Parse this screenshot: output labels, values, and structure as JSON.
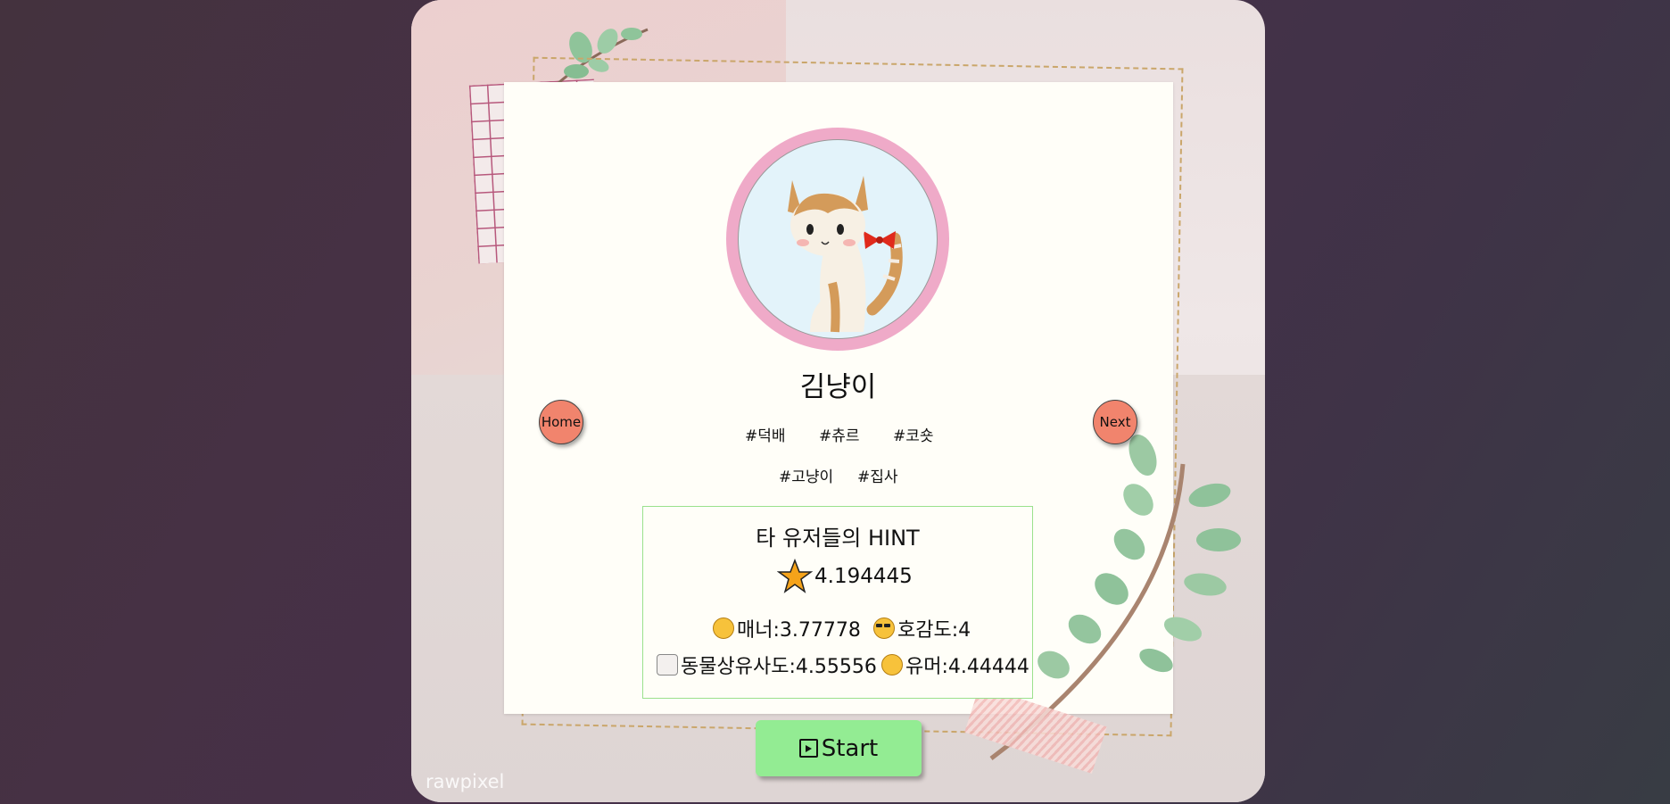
{
  "profile": {
    "name": "김냥이",
    "tags_row1": [
      "#덕배",
      "#츄르",
      "#코숏"
    ],
    "tags_row2": [
      "#고냥이",
      "#집사"
    ]
  },
  "nav": {
    "home_label": "Home",
    "next_label": "Next"
  },
  "hint": {
    "title": "타 유저들의 HINT",
    "rating": "4.194445",
    "stats": [
      {
        "label": "매너:3.77778",
        "icon": "smile-hug-icon"
      },
      {
        "label": "호감도:4",
        "icon": "sunglasses-icon"
      },
      {
        "label": "동물상유사도:4.55556",
        "icon": "rabbit-icon"
      },
      {
        "label": "유머:4.44444",
        "icon": "grin-icon"
      }
    ]
  },
  "start": {
    "label": "Start"
  },
  "watermark": "rawpixel",
  "colors": {
    "avatar_ring": "#efaac8",
    "nav_button": "#f1846d",
    "start_button": "#93ec93",
    "hint_border": "#9be18d",
    "star": "#f5a31a"
  }
}
